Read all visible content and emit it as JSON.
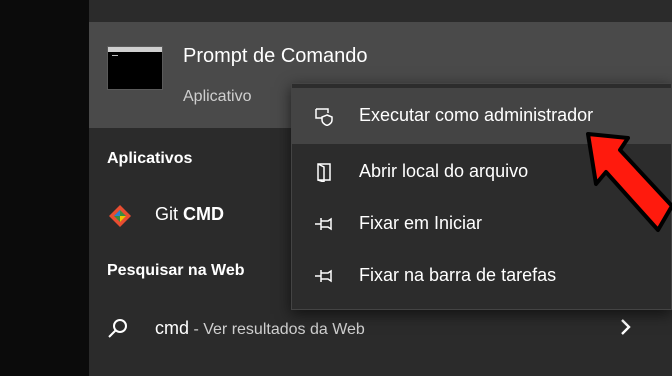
{
  "best_match": {
    "title": "Prompt de Comando",
    "subtitle": "Aplicativo"
  },
  "apps_section": {
    "heading": "Aplicativos",
    "items": [
      {
        "prefix": "Git ",
        "bold": "CMD",
        "icon": "git-icon"
      }
    ]
  },
  "web_section": {
    "heading": "Pesquisar na Web",
    "query": "cmd",
    "suffix": " - Ver resultados da Web",
    "icon": "search-icon"
  },
  "context_menu": {
    "items": [
      {
        "label": "Executar como administrador",
        "icon": "run-as-admin-icon",
        "highlighted": true
      },
      {
        "label": "Abrir local do arquivo",
        "icon": "open-file-location-icon"
      },
      {
        "label": "Fixar em Iniciar",
        "icon": "pin-icon"
      },
      {
        "label": "Fixar na barra de tarefas",
        "icon": "pin-taskbar-icon"
      }
    ]
  },
  "colors": {
    "panel_bg": "#2b2b2b",
    "highlight_bg": "#4a4a4a",
    "menu_bg": "#2c2c2c",
    "arrow": "#ff1a0d"
  }
}
